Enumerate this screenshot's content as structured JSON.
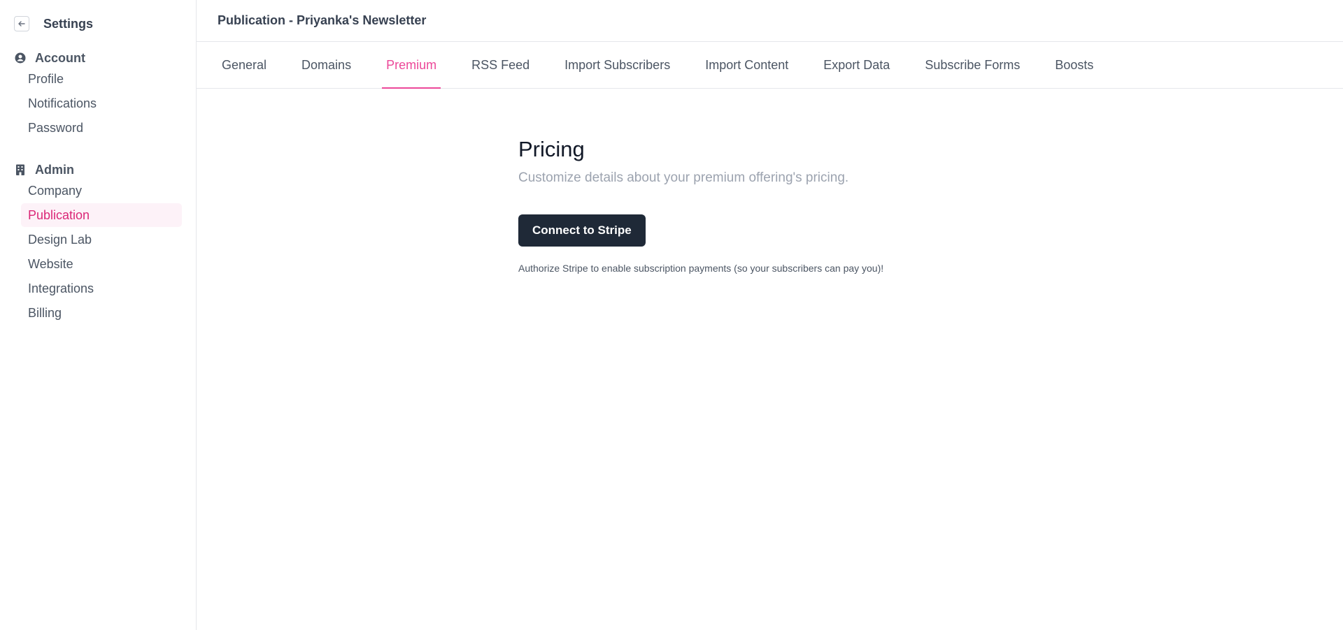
{
  "sidebar": {
    "title": "Settings",
    "back_icon": "arrow-left-icon",
    "sections": [
      {
        "label": "Account",
        "icon": "user-circle-icon",
        "items": [
          "Profile",
          "Notifications",
          "Password"
        ]
      },
      {
        "label": "Admin",
        "icon": "building-icon",
        "items": [
          "Company",
          "Publication",
          "Design Lab",
          "Website",
          "Integrations",
          "Billing"
        ],
        "active_item": "Publication"
      }
    ]
  },
  "header": {
    "title": "Publication - Priyanka's Newsletter"
  },
  "tabs": [
    {
      "label": "General"
    },
    {
      "label": "Domains"
    },
    {
      "label": "Premium",
      "active": true
    },
    {
      "label": "RSS Feed"
    },
    {
      "label": "Import Subscribers"
    },
    {
      "label": "Import Content"
    },
    {
      "label": "Export Data"
    },
    {
      "label": "Subscribe Forms"
    },
    {
      "label": "Boosts"
    }
  ],
  "pricing": {
    "title": "Pricing",
    "subtitle": "Customize details about your premium offering's pricing.",
    "connect_label": "Connect to Stripe",
    "note": "Authorize Stripe to enable subscription payments (so your subscribers can pay you)!"
  },
  "colors": {
    "accent": "#ec4899",
    "active_bg": "#fdf2f8",
    "button_bg": "#1f2937"
  }
}
